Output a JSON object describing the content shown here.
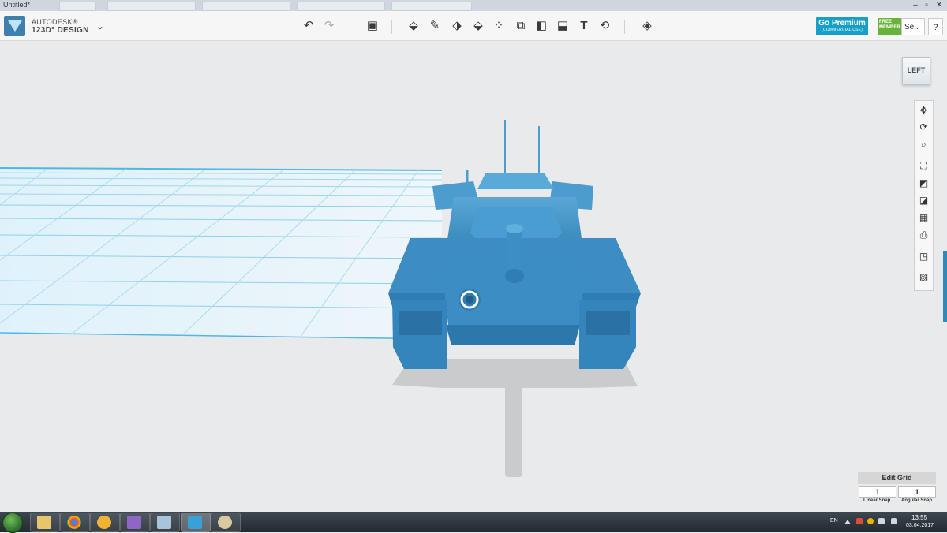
{
  "window": {
    "title": "Untitled*",
    "minimize": "–",
    "restore": "▫",
    "close": "✕"
  },
  "brand": {
    "line1": "AUTODESK®",
    "line2": "123D° DESIGN",
    "menu_icon": "chevron-down-icon",
    "menu_glyph": "⌄"
  },
  "toolbar": {
    "undo": "↶",
    "redo": "↷",
    "primitives": "▣",
    "sketch": "✎",
    "construct": "⬙",
    "modify": "⬗",
    "pattern": "⁘",
    "group": "⧉",
    "combine": "◧",
    "measure": "⬓",
    "text": "T",
    "snap": "⟲",
    "materials": "◈"
  },
  "account": {
    "premium_label": "Go Premium",
    "premium_sub": "(COMMERCIAL USE)",
    "free_badge": "FREE MEMBER",
    "signin_label": "Se..",
    "signin_chevron": "⌄",
    "help": "?"
  },
  "viewcube": {
    "face": "LEFT"
  },
  "nav": {
    "pan": "✥",
    "orbit": "⟳",
    "zoom": "⌕",
    "fit": "⛶",
    "views": "◩",
    "solid": "◪",
    "hide": "▦",
    "camera": "⎙",
    "material": "◳",
    "grid": "▨"
  },
  "edit_grid": {
    "title": "Edit Grid",
    "linear_value": "1",
    "angular_value": "1",
    "linear_label": "Linear Snap",
    "angular_label": "Angular Snap"
  },
  "taskbar": {
    "lang": "EN",
    "time": "13:55",
    "date": "03.04.2017"
  },
  "colors": {
    "accent": "#16a0c6",
    "model": "#3f93c6",
    "grid": "#7cc9ea",
    "free_green": "#69b33b",
    "taskbar": "#2b333a"
  }
}
